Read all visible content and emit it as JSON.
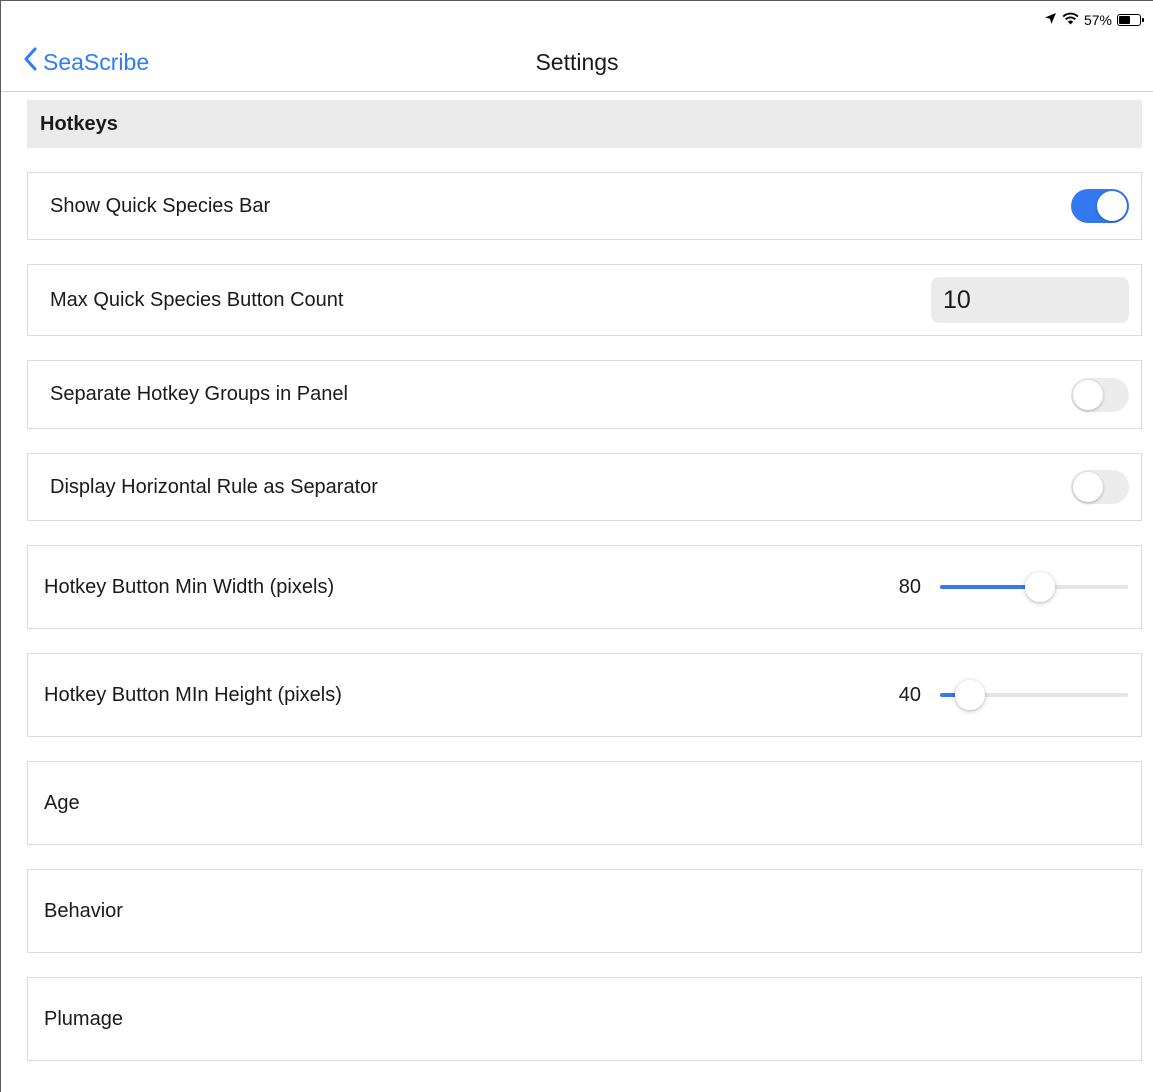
{
  "status_bar": {
    "location_icon": "location-arrow-icon",
    "wifi_icon": "wifi-icon",
    "battery_percent": "57%",
    "battery_level": 0.57
  },
  "navbar": {
    "back_label": "SeaScribe",
    "back_icon": "chevron-left-icon",
    "title": "Settings"
  },
  "section": {
    "title": "Hotkeys"
  },
  "settings": {
    "show_quick_species_bar": {
      "label": "Show Quick Species Bar",
      "on": true
    },
    "max_quick_species_button_count": {
      "label": "Max Quick Species Button Count",
      "value": "10"
    },
    "separate_hotkey_groups": {
      "label": "Separate Hotkey Groups in Panel",
      "on": false
    },
    "display_horizontal_rule": {
      "label": "Display Horizontal Rule as Separator",
      "on": false
    },
    "hotkey_min_width": {
      "label": "Hotkey Button Min Width (pixels)",
      "value": "80",
      "fraction": 0.53
    },
    "hotkey_min_height": {
      "label": "Hotkey Button MIn Height (pixels)",
      "value": "40",
      "fraction": 0.16
    },
    "age": {
      "label": "Age"
    },
    "behavior": {
      "label": "Behavior"
    },
    "plumage": {
      "label": "Plumage"
    }
  },
  "colors": {
    "accent": "#2f7cf6",
    "toggle_on": "#3479f0",
    "section_bg": "#ebebeb",
    "row_border": "#dcdcdc"
  }
}
